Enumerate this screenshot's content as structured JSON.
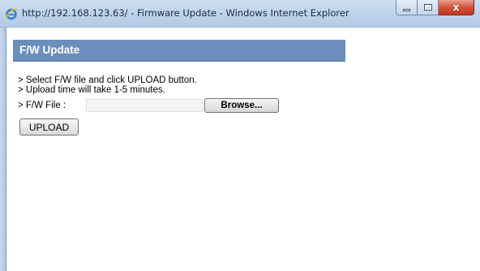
{
  "window": {
    "title": "http://192.168.123.63/ - Firmware Update - Windows Internet Explorer",
    "browser_icon": "internet-explorer-icon",
    "caption_buttons": {
      "minimize_icon": "minimize-icon",
      "maximize_icon": "maximize-icon",
      "close_icon": "close-icon",
      "close_glyph": "x"
    }
  },
  "page": {
    "header_title": "F/W Update",
    "instructions": [
      "> Select F/W file and click UPLOAD button.",
      "> Upload time will take 1-5 minutes."
    ],
    "file_label": "> F/W File :",
    "file_value": "",
    "browse_label": "Browse...",
    "upload_label": "UPLOAD"
  },
  "colors": {
    "header_bar": "#6b8ebd",
    "header_text": "#ffffff",
    "close_button": "#c8432b"
  }
}
